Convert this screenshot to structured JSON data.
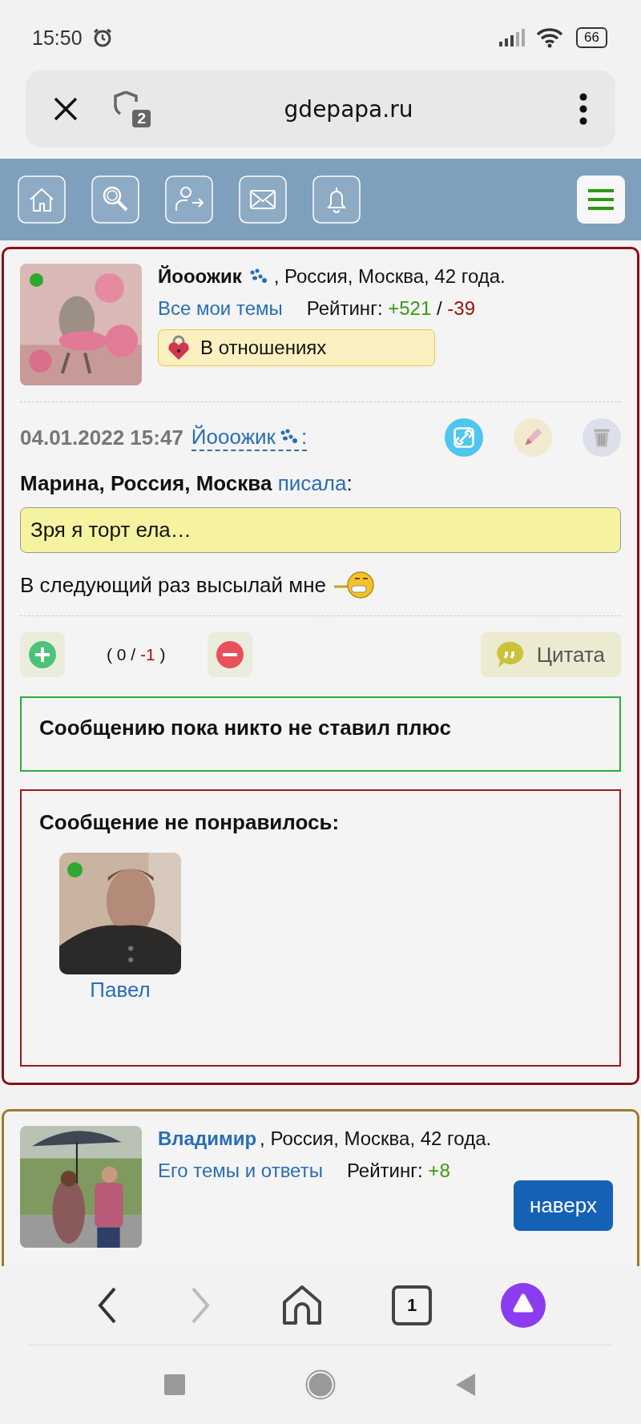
{
  "status_bar": {
    "time": "15:50",
    "battery": "66"
  },
  "browser": {
    "url": "gdepapa.ru",
    "shield_count": "2",
    "tabs_count": "1"
  },
  "post": {
    "author": {
      "name": "Йооожик",
      "location": ", Россия, Москва, 42 года.",
      "online": true,
      "topics_link": "Все мои темы",
      "rating_label": "Рейтинг:",
      "rating_plus": "+521",
      "rating_sep": "/",
      "rating_minus": "-39",
      "status_badge": "В отношениях"
    },
    "date": "04.01.2022 15:47",
    "author_link": "Йооожик",
    "author_link_colon": ":",
    "quote_author": "Марина, Россия, Москва",
    "quote_link": "писала",
    "quote_tail": ":",
    "quote": "Зря я торт ела…",
    "message": "В следующий раз высылай мне",
    "votes": {
      "open": "(",
      "plus": "0",
      "sep": "/",
      "minus": "-1",
      "close": ")"
    },
    "quote_button": "Цитата",
    "plus_box": "Сообщению пока никто не ставил плюс",
    "minus_box": {
      "title": "Сообщение не понравилось:",
      "users": [
        {
          "name": "Павел",
          "online": true
        }
      ]
    }
  },
  "next_post": {
    "author": {
      "name": "Владимир",
      "location": ", Россия, Москва, 42 года.",
      "topics_link": "Его темы и ответы",
      "rating_label": "Рейтинг:",
      "rating_plus": "+8"
    }
  },
  "scroll_top_button": "наверх"
}
